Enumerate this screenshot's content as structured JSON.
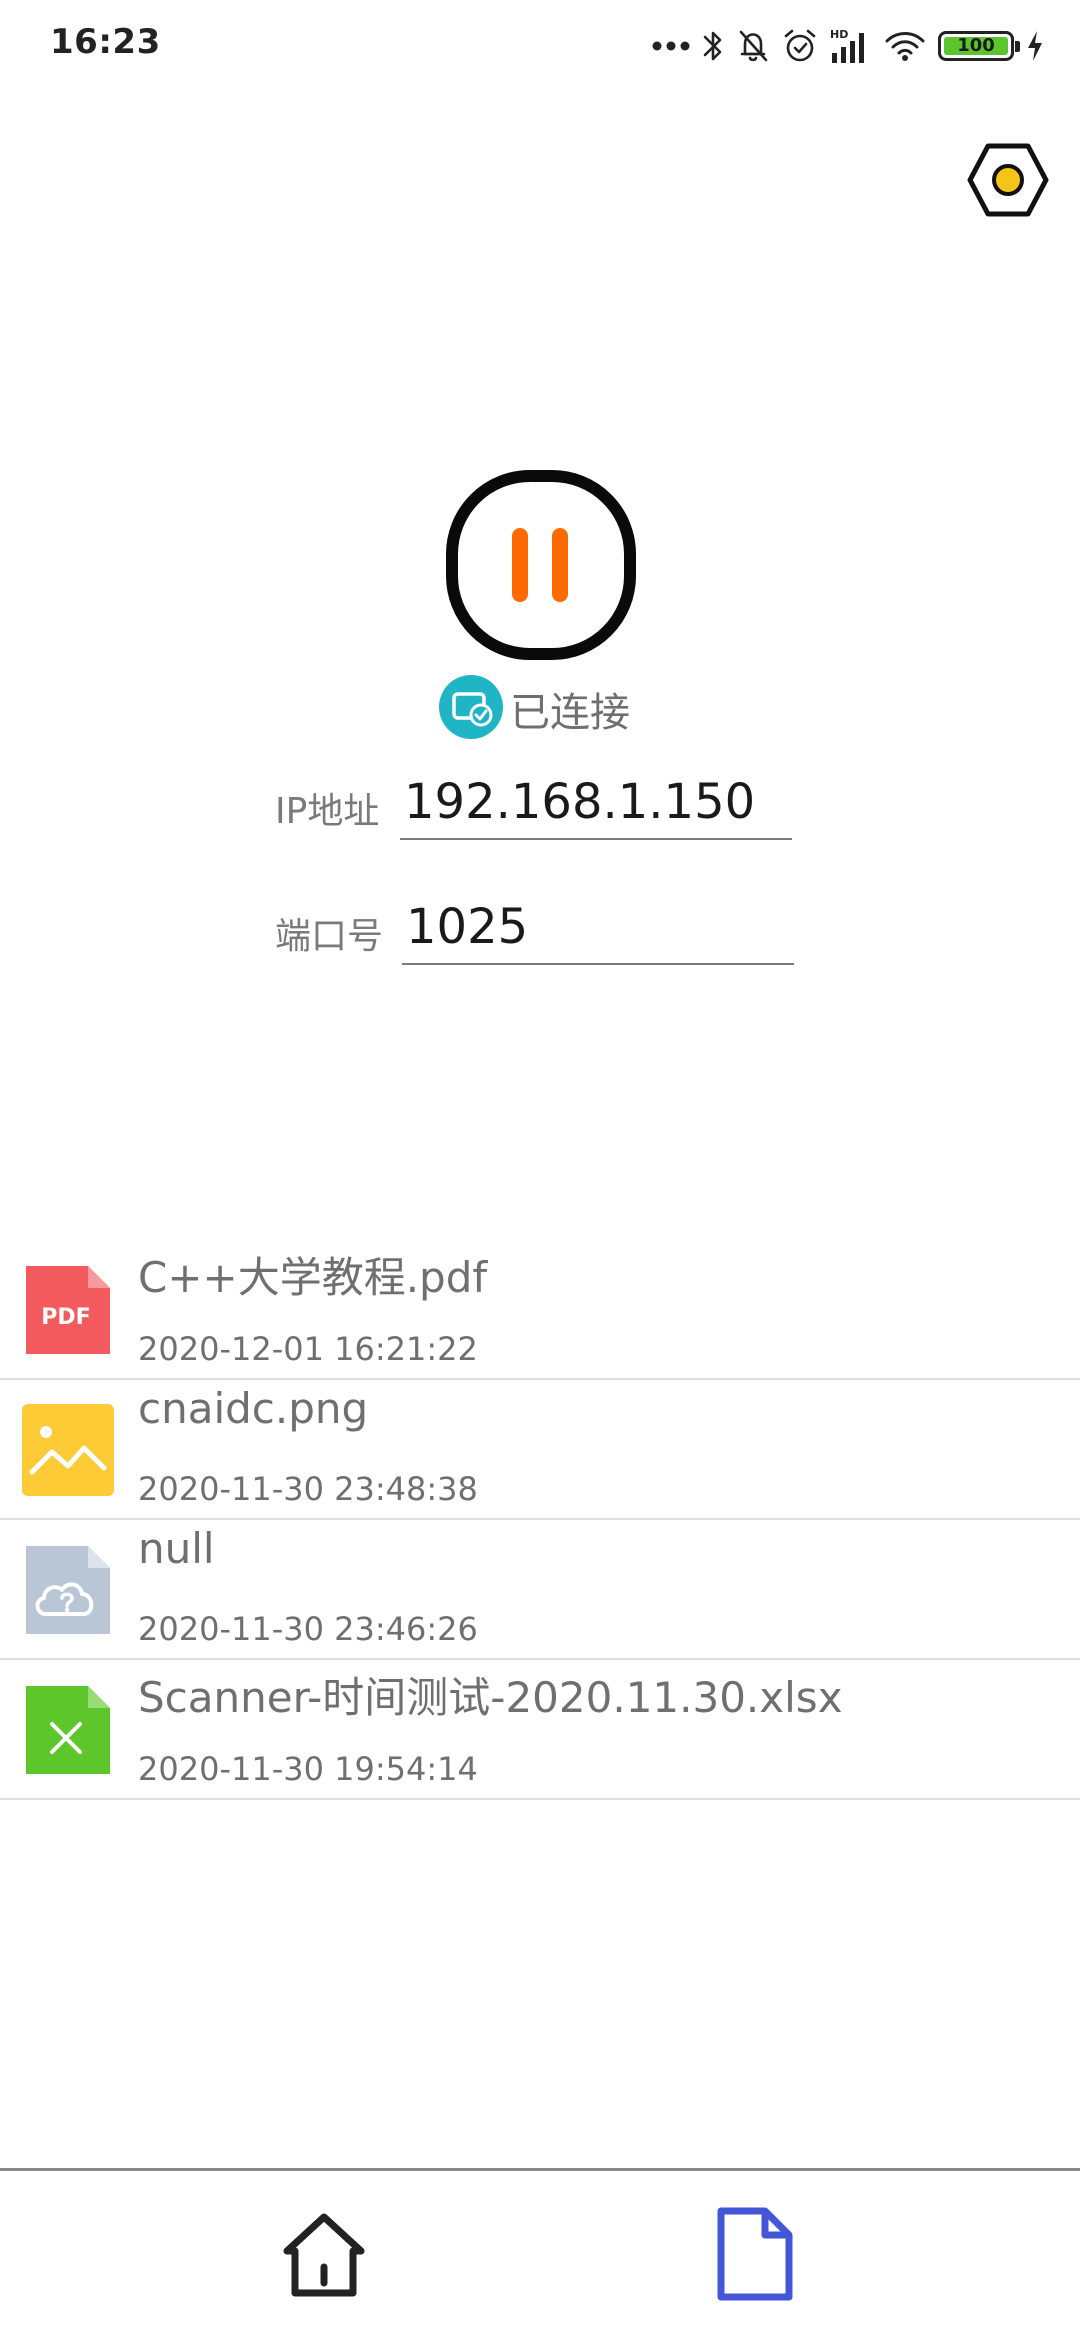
{
  "status_bar": {
    "time": "16:23",
    "battery_level": "100",
    "icons": [
      "more-dots-icon",
      "bluetooth-icon",
      "bell-muted-icon",
      "alarm-icon",
      "signal-hd-icon",
      "wifi-icon",
      "battery-icon",
      "charging-icon"
    ]
  },
  "connection": {
    "status_label": "已连接",
    "ip_label": "IP地址",
    "ip_value": "192.168.1.150",
    "port_label": "端口号",
    "port_value": "1025",
    "toggle_state": "pause"
  },
  "files": [
    {
      "name": "C++大学教程.pdf",
      "date": "2020-12-01 16:21:22",
      "type": "pdf",
      "icon_text": "PDF"
    },
    {
      "name": "cnaidc.png",
      "date": "2020-11-30 23:48:38",
      "type": "image"
    },
    {
      "name": "null",
      "date": "2020-11-30 23:46:26",
      "type": "unknown"
    },
    {
      "name": "Scanner-时间测试-2020.11.30.xlsx",
      "date": "2020-11-30 19:54:14",
      "type": "excel"
    }
  ],
  "bottom_nav": {
    "items": [
      {
        "name": "home",
        "icon": "home-icon",
        "active": false
      },
      {
        "name": "files",
        "icon": "file-icon",
        "active": true
      }
    ]
  },
  "colors": {
    "accent_orange": "#ff6a00",
    "nav_active": "#4356d6",
    "status_teal": "#1fb5c4",
    "pdf_red": "#f25a5e",
    "image_yellow": "#fccb36",
    "unknown_gray": "#b8c6d6",
    "excel_green": "#5dc62b",
    "settings_yellow": "#f6c417"
  }
}
